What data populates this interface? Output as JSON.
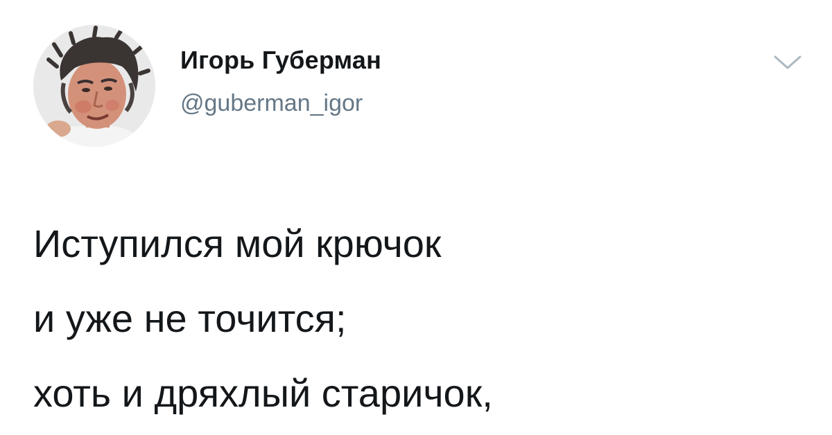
{
  "author": {
    "name": "Игорь Губерман",
    "handle": "@guberman_igor",
    "avatar_icon": "author-avatar-photo"
  },
  "menu": {
    "icon": "chevron-down-icon"
  },
  "tweet": {
    "lines": [
      "Иступился мой крючок",
      "и уже не точится;",
      "хоть и дряхлый старичок,"
    ]
  },
  "colors": {
    "text": "#14171a",
    "secondary": "#657786",
    "caret": "#aab8c2"
  }
}
